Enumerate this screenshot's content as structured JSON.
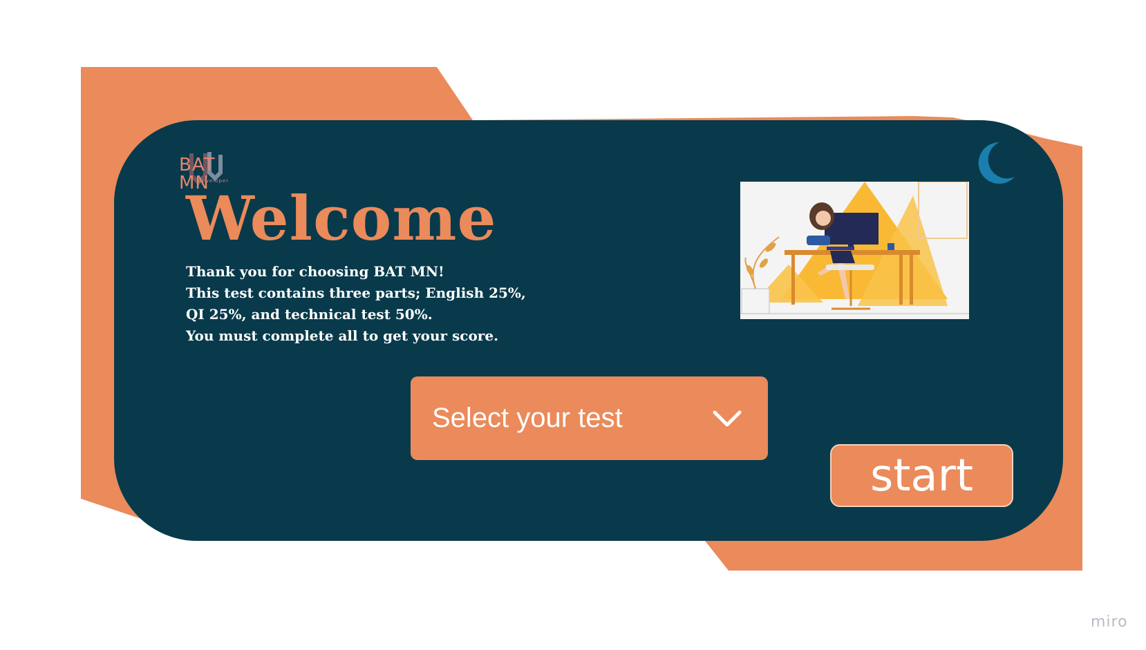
{
  "brand": {
    "logo_text": "BAT MN",
    "logo_sub": "developer"
  },
  "welcome": {
    "title": "Welcome",
    "lines": [
      "Thank you for choosing BAT MN!",
      "This test contains three parts; English 25%,",
      "QI 25%, and technical test 50%.",
      "You must complete all to get your score."
    ]
  },
  "test_select": {
    "placeholder": "Select your test"
  },
  "actions": {
    "start_label": "start"
  },
  "icons": {
    "theme_toggle": "moon-icon",
    "dropdown": "chevron-down-icon"
  },
  "colors": {
    "accent": "#eb8a5a",
    "card": "#083a4b",
    "moon": "#1a7fae",
    "illustration_yellow": "#f9b934"
  },
  "watermark": "miro"
}
